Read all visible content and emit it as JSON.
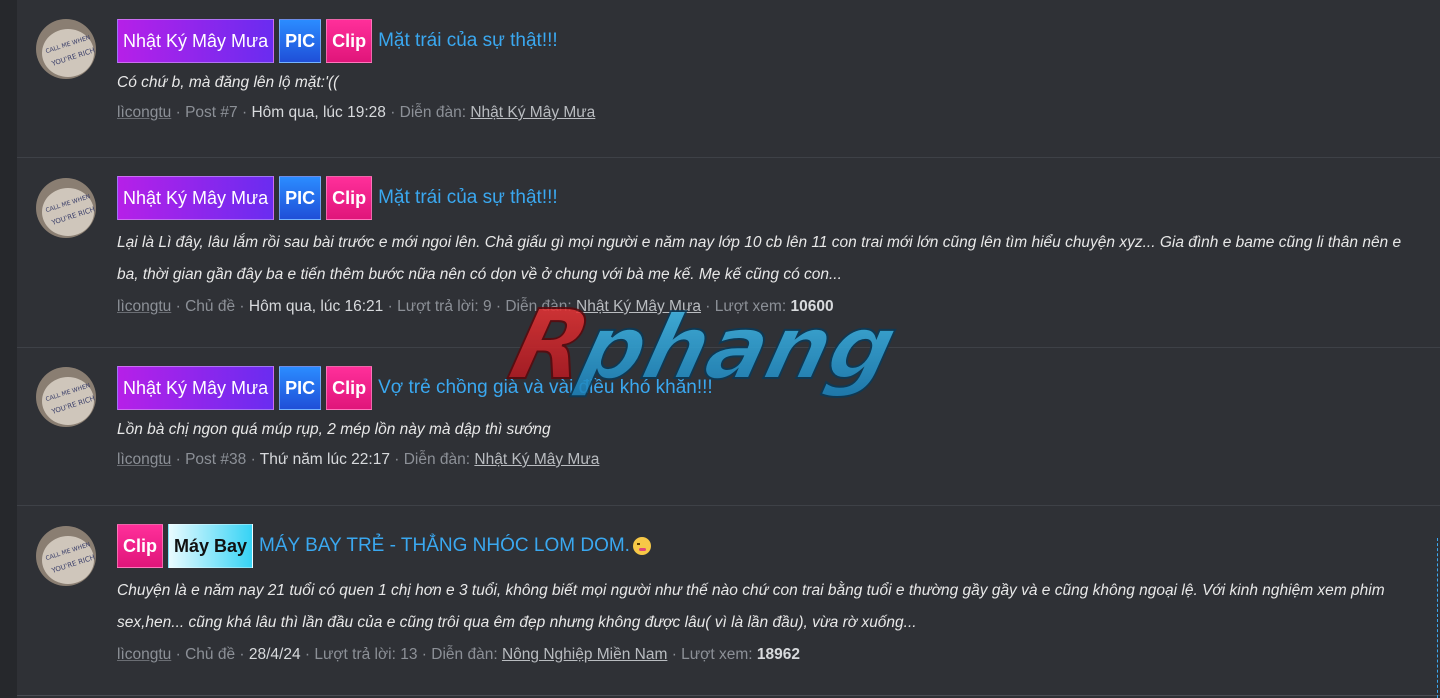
{
  "items": [
    {
      "labels": [
        "Nhật Ký Mây Mưa",
        "PIC",
        "Clip"
      ],
      "title": "Mặt trái của sự thật!!!",
      "snippet_lines": [
        "Có chứ b, mà đăng lên lộ mặt:'(("
      ],
      "meta": {
        "user": "lìcongtu",
        "post": "Post #7",
        "time": "Hôm qua, lúc 19:28",
        "forum_label": "Diễn đàn:",
        "forum": "Nhật Ký Mây Mưa"
      }
    },
    {
      "labels": [
        "Nhật Ký Mây Mưa",
        "PIC",
        "Clip"
      ],
      "title": "Mặt trái của sự thật!!!",
      "snippet_lines": [
        "Lại là Lì đây, lâu lắm rồi sau bài trước e mới ngoi lên. Chả giấu gì mọi người e năm nay lớp 10 cb lên 11 con trai mới lớn cũng lên tìm hiểu chuyện xyz... Gia đình e bame cũng li thân nên e",
        "ba, thời gian gần đây ba e tiến thêm bước nữa nên có dọn về ở chung với bà mẹ kế. Mẹ kế cũng có con..."
      ],
      "meta": {
        "user": "lìcongtu",
        "post": "Chủ đề",
        "time": "Hôm qua, lúc 16:21",
        "replies_label": "Lượt trả lời:",
        "replies": "9",
        "forum_label": "Diễn đàn:",
        "forum": "Nhật Ký Mây Mưa",
        "views_label": "Lượt xem:",
        "views": "10600"
      }
    },
    {
      "labels": [
        "Nhật Ký Mây Mưa",
        "PIC",
        "Clip"
      ],
      "title": "Vợ trẻ chồng già và vài điều khó khăn!!!",
      "snippet_lines": [
        "Lồn bà chị ngon quá múp rụp, 2 mép lồn này mà dập thì sướng"
      ],
      "meta": {
        "user": "lìcongtu",
        "post": "Post #38",
        "time": "Thứ năm lúc 22:17",
        "forum_label": "Diễn đàn:",
        "forum": "Nhật Ký Mây Mưa"
      }
    },
    {
      "labels": [
        "Clip",
        "Máy Bay"
      ],
      "title": "MÁY BAY TRẺ - THẲNG NHÓC LOM DOM.",
      "snippet_lines": [
        "Chuyện là e năm nay 21 tuổi có quen 1 chị hơn e 3 tuổi, không biết mọi người như thế nào chứ con trai bằng tuổi e thường gầy gầy và e cũng không ngoại lệ. Với kinh nghiệm xem phim",
        "sex,hen... cũng khá lâu thì lần đầu của e cũng trôi qua êm đẹp nhưng không được lâu( vì là lần đầu), vừa rờ xuống..."
      ],
      "meta": {
        "user": "lìcongtu",
        "post": "Chủ đề",
        "time": "28/4/24",
        "replies_label": "Lượt trả lời:",
        "replies": "13",
        "forum_label": "Diễn đàn:",
        "forum": "Nông Nghiệp Miền Nam",
        "views_label": "Lượt xem:",
        "views": "18962"
      }
    }
  ],
  "sep": "·",
  "watermark": "Rphang",
  "avatar_text": [
    "CALL ME WHEN",
    "YOU'RE RICH"
  ],
  "colors": {
    "background": "#2e3035",
    "title": "#3aa8f0",
    "label_forum": "#8a28ee",
    "label_pic": "#2a6cf0",
    "label_clip": "#f0208a",
    "label_maybay": "#36d3f5",
    "watermark_red": "#d0202a",
    "watermark_blue": "#2aa3d8"
  }
}
